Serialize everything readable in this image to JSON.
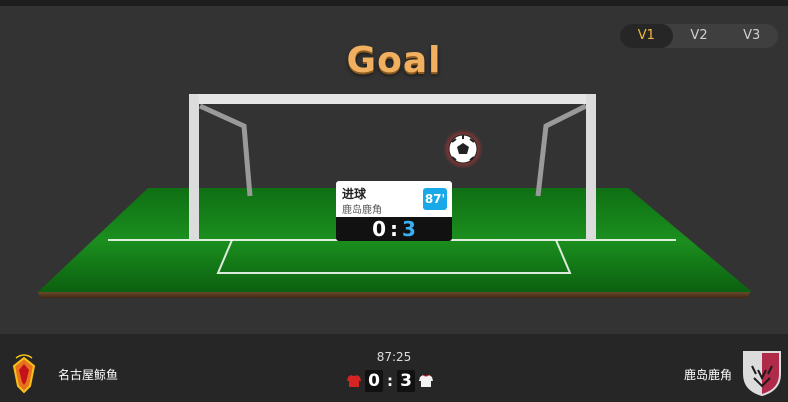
{
  "versions": [
    "V1",
    "V2",
    "V3"
  ],
  "active_version": "V1",
  "title": "Goal",
  "event": {
    "type": "进球",
    "team": "鹿岛鹿角",
    "minute": "87'",
    "home_score": "0",
    "separator": ":",
    "away_score": "3"
  },
  "match": {
    "time": "87:25",
    "home_team": "名古屋鲸鱼",
    "away_team": "鹿岛鹿角",
    "home_score": "0",
    "away_score": "3",
    "separator": ":"
  },
  "colors": {
    "accent": "#f0b838",
    "away_accent": "#3ab0f2",
    "minute_badge": "#19a9e8",
    "pitch": "#1f9a1f"
  },
  "icons": {
    "ball": "soccer-ball-icon",
    "home_logo": "nagoya-grampus-logo",
    "away_logo": "kashima-antlers-logo",
    "home_shirt": "red-jersey-icon",
    "away_shirt": "white-jersey-icon"
  }
}
